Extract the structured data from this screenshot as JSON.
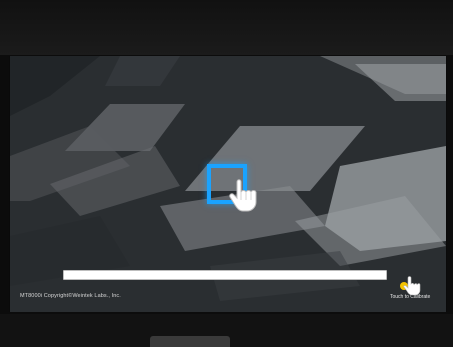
{
  "calibration": {
    "copyright": "MT8000i Copyright©Weintek Labs., Inc.",
    "touch_label": "Touch to Calibrate",
    "progress": 1.0
  },
  "icons": {
    "pointer": "hand-pointer-icon",
    "target": "calibration-target-icon",
    "touch": "touch-hand-icon"
  },
  "colors": {
    "target_border": "#1aa3ff",
    "screen_bg": "#2c3033",
    "progress_bar": "#ffffff"
  }
}
